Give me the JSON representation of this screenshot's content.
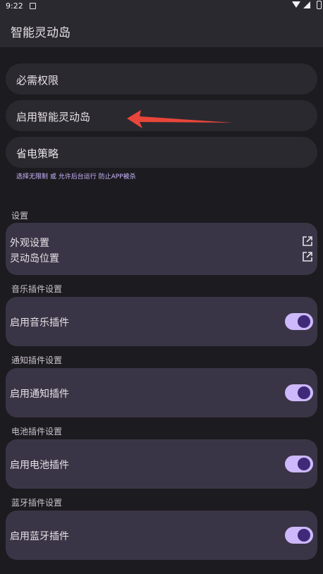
{
  "status": {
    "time": "9:22",
    "icons": [
      "app-notification-icon",
      "wifi-icon",
      "signal-icon",
      "battery-icon"
    ]
  },
  "app": {
    "title": "智能灵动岛"
  },
  "permissions": {
    "items": [
      {
        "label": "必需权限"
      },
      {
        "label": "启用智能灵动岛"
      },
      {
        "label": "省电策略"
      }
    ],
    "hint": "选择无限制 或 允许后台运行 防止APP被杀"
  },
  "settings": {
    "title": "设置",
    "items": [
      {
        "label": "外观设置",
        "icon": "open-in-new-icon"
      },
      {
        "label": "灵动岛位置",
        "icon": "open-in-new-icon"
      }
    ]
  },
  "plugins": [
    {
      "title": "音乐插件设置",
      "label": "启用音乐插件",
      "enabled": true
    },
    {
      "title": "通知插件设置",
      "label": "启用通知插件",
      "enabled": true
    },
    {
      "title": "电池插件设置",
      "label": "启用电池插件",
      "enabled": true
    },
    {
      "title": "蓝牙插件设置",
      "label": "启用蓝牙插件",
      "enabled": true
    }
  ],
  "colors": {
    "background": "#1c1b1f",
    "card": "#3a3546",
    "switch_track": "#cdb8fb",
    "switch_thumb": "#3f2a7a",
    "hint": "#cbb8ff",
    "arrow": "#e8463a"
  }
}
